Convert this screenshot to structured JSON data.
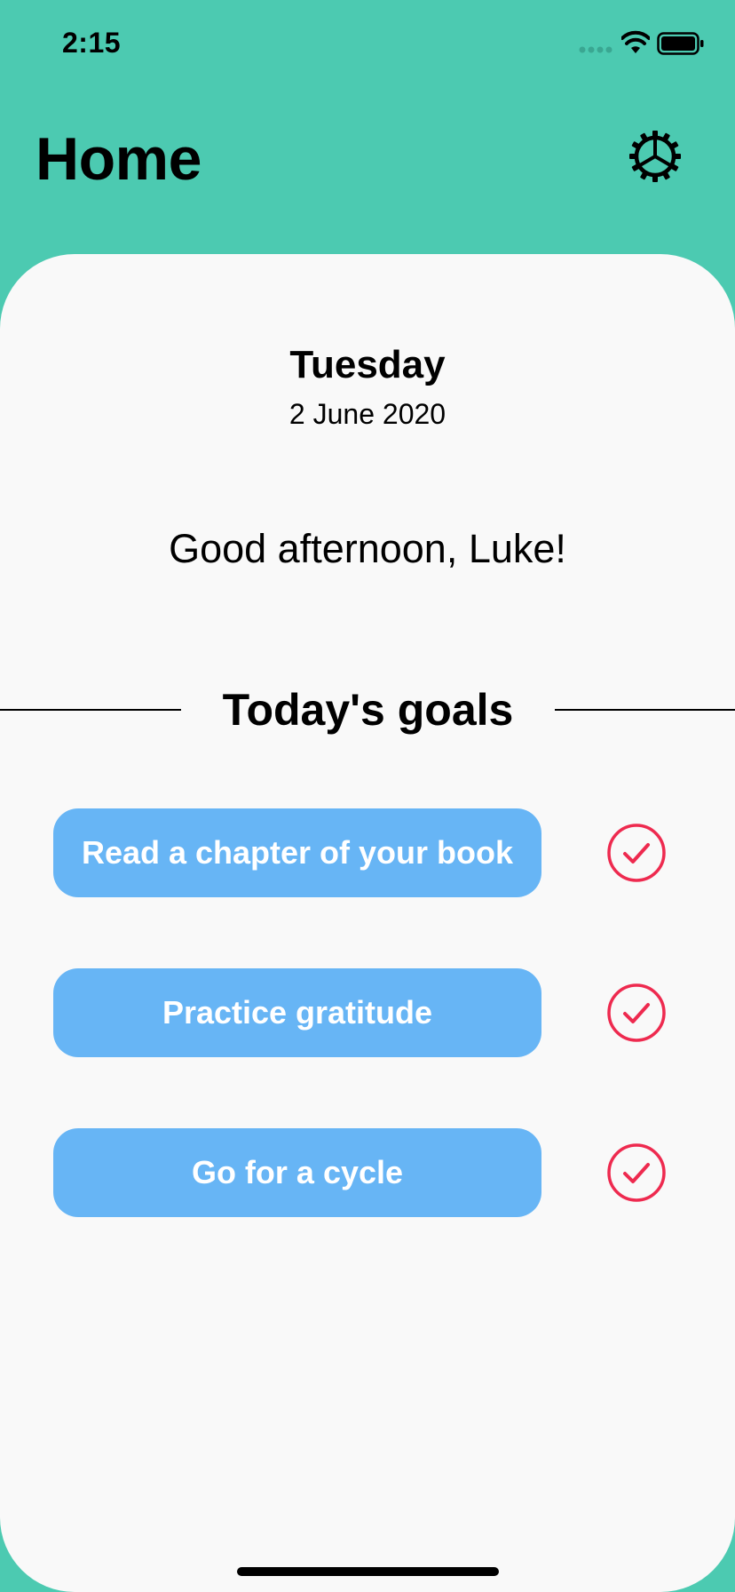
{
  "status_bar": {
    "time": "2:15"
  },
  "header": {
    "title": "Home",
    "settings_icon": "gear-icon"
  },
  "date": {
    "day": "Tuesday",
    "full_date": "2 June 2020"
  },
  "greeting": "Good afternoon, Luke!",
  "goals": {
    "title": "Today's goals",
    "items": [
      {
        "label": "Read a chapter of your book",
        "check_icon": "check-circle-icon"
      },
      {
        "label": "Practice gratitude",
        "check_icon": "check-circle-icon"
      },
      {
        "label": "Go for a cycle",
        "check_icon": "check-circle-icon"
      }
    ]
  },
  "colors": {
    "header_background": "#4ccab1",
    "card_background": "#f9f9f9",
    "goal_button": "#67b5f5",
    "check_accent": "#ee2a4f"
  }
}
